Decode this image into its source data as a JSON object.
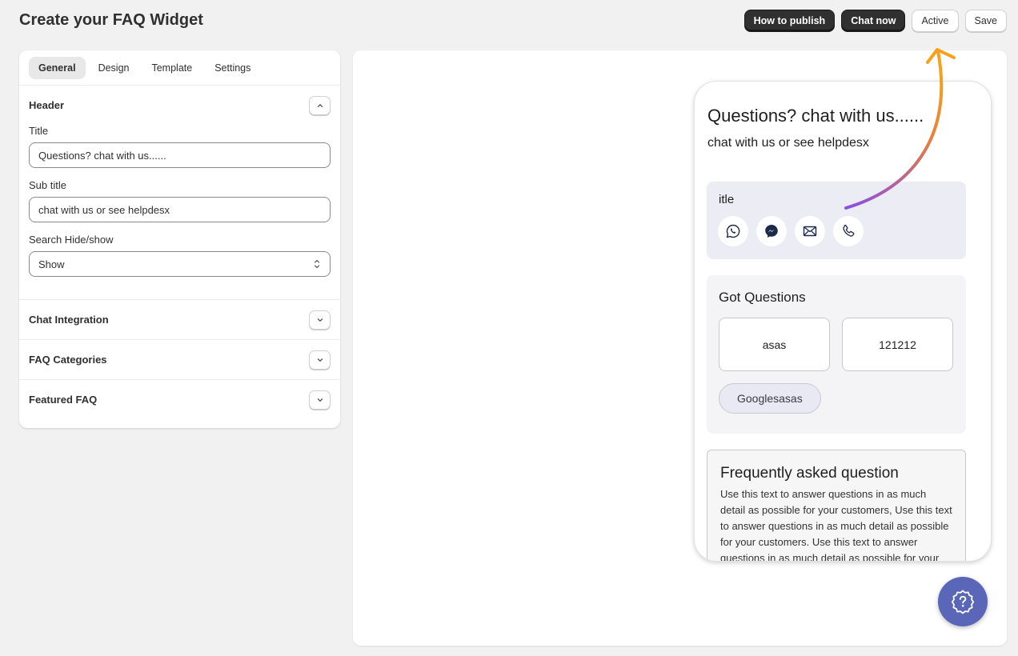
{
  "page": {
    "title": "Create your FAQ Widget"
  },
  "actions": {
    "how_to_publish": "How to publish",
    "chat_now": "Chat now",
    "active": "Active",
    "save": "Save"
  },
  "tabs": [
    "General",
    "Design",
    "Template",
    "Settings"
  ],
  "header_section": {
    "title": "Header",
    "title_label": "Title",
    "title_value": "Questions? chat with us......",
    "subtitle_label": "Sub title",
    "subtitle_value": "chat with us or see helpdesx",
    "search_label": "Search Hide/show",
    "search_value": "Show"
  },
  "sections": [
    "Chat Integration",
    "FAQ Categories",
    "Featured FAQ"
  ],
  "widget": {
    "title": "Questions? chat with us......",
    "subtitle": "chat with us or see helpdesx",
    "contact_label": "itle",
    "contact_icons": [
      "whatsapp-icon",
      "messenger-icon",
      "mail-icon",
      "phone-icon"
    ],
    "got_questions": "Got Questions",
    "categories": [
      "asas",
      "121212"
    ],
    "pill": "Googlesasas",
    "faq_title": "Frequently asked question",
    "faq_body": "Use this text to answer questions in as much detail as possible for your customers, Use this text to answer questions in as much detail as possible for your customers. Use this text to answer questions in as much detail as possible for your customers."
  },
  "colors": {
    "accent": "#5a67b8",
    "dark_button": "#303030",
    "arrow_start": "#f5a11c",
    "arrow_end": "#8a4fe0"
  }
}
